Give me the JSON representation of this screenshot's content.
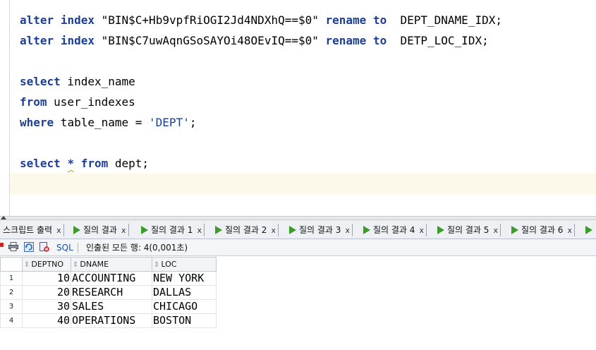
{
  "editor": {
    "lines": [
      {
        "kw1": "alter",
        "kw2": "index",
        "name": "\"BIN$C+Hb9vpfRiOGI2Jd4NDXhQ==$0\"",
        "kw3": "rename",
        "kw4": "to",
        "target": "DEPT_DNAME_IDX;"
      },
      {
        "kw1": "alter",
        "kw2": "index",
        "name": "\"BIN$C7uwAqnGSoSAYOi48OEvIQ==$0\"",
        "kw3": "rename",
        "kw4": "to",
        "target": "DETP_LOC_IDX;"
      }
    ],
    "select1": {
      "kw": "select",
      "rest": " index_name"
    },
    "from1": {
      "kw": "from",
      "rest": " user_indexes"
    },
    "where1": {
      "kw": "where",
      "mid": " table_name = ",
      "str": "'DEPT'",
      "end": ";"
    },
    "select2": {
      "kw1": "select",
      "star": "*",
      "kw2": "from",
      "rest": " dept;"
    }
  },
  "tabs": [
    {
      "label": "스크립트 출력",
      "close": "x",
      "play": false
    },
    {
      "label": "질의 결과",
      "close": "x",
      "play": true
    },
    {
      "label": "질의 결과 1",
      "close": "x",
      "play": true
    },
    {
      "label": "질의 결과 2",
      "close": "x",
      "play": true
    },
    {
      "label": "질의 결과 3",
      "close": "x",
      "play": true
    },
    {
      "label": "질의 결과 4",
      "close": "x",
      "play": true
    },
    {
      "label": "질의 결과 5",
      "close": "x",
      "play": true
    },
    {
      "label": "질의 결과 6",
      "close": "x",
      "play": true
    }
  ],
  "toolbar": {
    "sql_label": "SQL",
    "status": "인출된 모든 행: 4(0,001초)"
  },
  "grid": {
    "columns": [
      "DEPTNO",
      "DNAME",
      "LOC"
    ],
    "rows": [
      {
        "num": "1",
        "deptno": "10",
        "dname": "ACCOUNTING",
        "loc": "NEW YORK"
      },
      {
        "num": "2",
        "deptno": "20",
        "dname": "RESEARCH",
        "loc": "DALLAS"
      },
      {
        "num": "3",
        "deptno": "30",
        "dname": "SALES",
        "loc": "CHICAGO"
      },
      {
        "num": "4",
        "deptno": "40",
        "dname": "OPERATIONS",
        "loc": "BOSTON"
      }
    ]
  }
}
